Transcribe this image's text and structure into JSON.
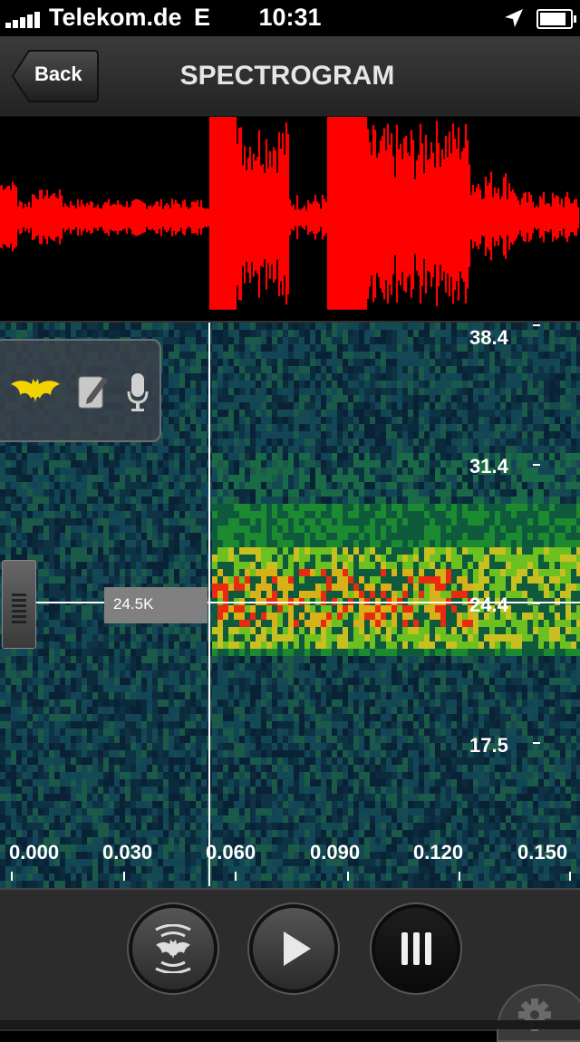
{
  "status_bar": {
    "carrier": "Telekom.de",
    "network": "E",
    "time": "10:31"
  },
  "nav": {
    "back_label": "Back",
    "title": "SPECTROGRAM"
  },
  "spectrogram": {
    "frequency_labels": [
      "38.4",
      "31.4",
      "24.4",
      "17.5"
    ],
    "time_labels": [
      "0.000",
      "0.030",
      "0.060",
      "0.090",
      "0.120",
      "0.150"
    ],
    "cursor_frequency": "24.5K"
  },
  "colors": {
    "waveform": "#ff0000",
    "spectrogram_bg": "#061424",
    "bat_icon": "#f2d400"
  },
  "icons": {
    "tool_panel": [
      "bat-icon",
      "note-icon",
      "microphone-icon"
    ],
    "controls": [
      "bat-signal-icon",
      "play-icon",
      "pause-icon"
    ],
    "settings": "gear-icon"
  }
}
